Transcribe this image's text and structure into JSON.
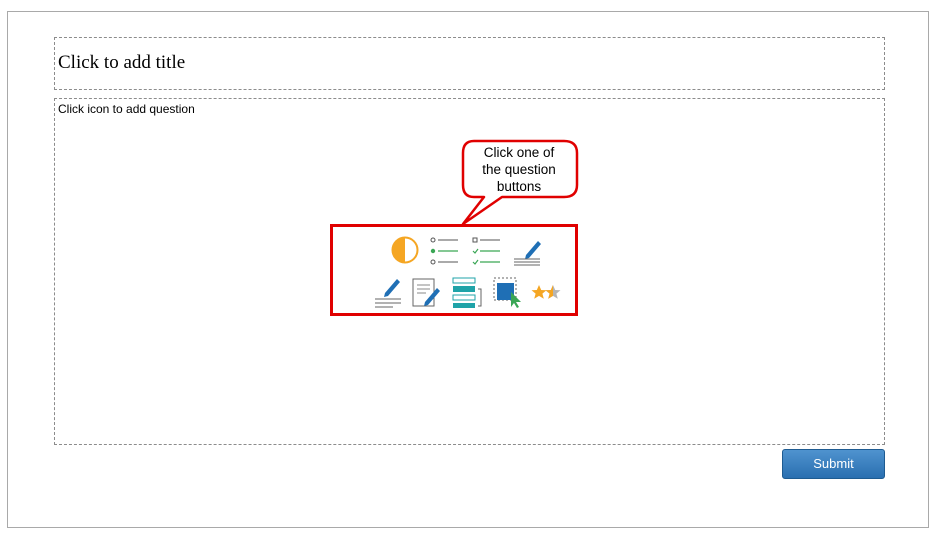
{
  "title_placeholder": "Click to add title",
  "question_hint": "Click icon to add question",
  "callout": {
    "lines": [
      "Click one of",
      "the question",
      "buttons"
    ]
  },
  "question_icons": [
    {
      "icon": "pie-chart-icon",
      "type": "poll"
    },
    {
      "icon": "radio-list-icon",
      "type": "single-choice"
    },
    {
      "icon": "checkbox-list-icon",
      "type": "multiple-choice"
    },
    {
      "icon": "pen-lines-icon",
      "type": "short-answer"
    },
    {
      "icon": "pen-line-icon",
      "type": "fill-in-blank"
    },
    {
      "icon": "document-pen-icon",
      "type": "essay"
    },
    {
      "icon": "ranking-list-icon",
      "type": "ranking"
    },
    {
      "icon": "hotspot-cursor-icon",
      "type": "hotspot"
    },
    {
      "icon": "rating-stars-icon",
      "type": "rating"
    }
  ],
  "submit_label": "Submit",
  "colors": {
    "highlight": "#e00000",
    "icon_blue": "#1f6fb5",
    "icon_orange": "#f5a623",
    "icon_green": "#3aa655",
    "icon_teal": "#1fa3a8",
    "submit_bg": "#2f78bd"
  }
}
